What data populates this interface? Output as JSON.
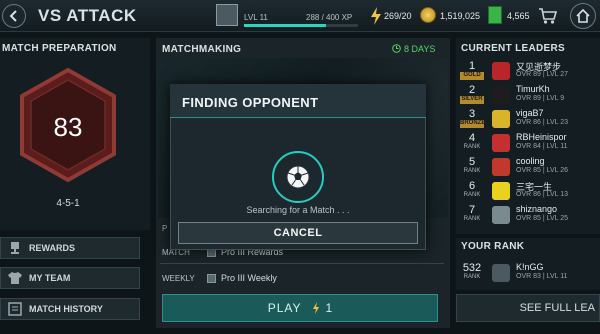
{
  "topbar": {
    "title": "VS ATTACK",
    "level_label": "LVL 11",
    "xp_label": "288 / 400 XP",
    "xp_progress": 0.72,
    "energy": "269/20",
    "coins": "1,519,025",
    "gems": "4,565"
  },
  "match_preparation": {
    "header": "MATCH PREPARATION",
    "team_rating": "83",
    "formation": "4-5-1"
  },
  "side_menu": {
    "rewards": "REWARDS",
    "my_team": "MY TEAM",
    "match_history": "MATCH HISTORY"
  },
  "matchmaking": {
    "header": "MATCHMAKING",
    "days_left": "8 DAYS",
    "prize_header": "P",
    "match_label": "MATCH",
    "match_value": "Pro III Rewards",
    "weekly_label": "WEEKLY",
    "weekly_value": "Pro III Weekly",
    "play_label": "PLAY",
    "play_cost": "1"
  },
  "modal": {
    "title": "FINDING OPPONENT",
    "status": "Searching for a Match . . .",
    "cancel_label": "CANCEL"
  },
  "leaders": {
    "header": "CURRENT LEADERS",
    "rows": [
      {
        "rank": "1",
        "sub": "GOLD",
        "name": "又见逝梦步",
        "stats": "OVR 89 | LVL 27",
        "badge_color": "#b8252b"
      },
      {
        "rank": "2",
        "sub": "SILVER",
        "name": "TimurKh",
        "stats": "OVR 89 | LVL 9",
        "badge_color": "#1d1d1d"
      },
      {
        "rank": "3",
        "sub": "BRONZE",
        "name": "vigaB7",
        "stats": "OVR 86 | LVL 23",
        "badge_color": "#d9b42a"
      },
      {
        "rank": "4",
        "sub": "RANK",
        "name": "RBHeinispor",
        "stats": "OVR 84 | LVL 11",
        "badge_color": "#c43030"
      },
      {
        "rank": "5",
        "sub": "RANK",
        "name": "cooling",
        "stats": "OVR 85 | LVL 26",
        "badge_color": "#c0392b"
      },
      {
        "rank": "6",
        "sub": "RANK",
        "name": "三宅一生",
        "stats": "OVR 86 | LVL 13",
        "badge_color": "#e8d21d"
      },
      {
        "rank": "7",
        "sub": "RANK",
        "name": "shiznango",
        "stats": "OVR 85 | LVL 25",
        "badge_color": "#7a8a8f"
      }
    ]
  },
  "your_rank": {
    "header": "YOUR RANK",
    "rank": "532",
    "sub": "RANK",
    "name": "K!nGG",
    "stats": "OVR 83 | LVL 11"
  },
  "see_full_label": "SEE FULL LEA",
  "colors": {
    "accent": "#28cbbf",
    "panel": "#141d21",
    "hex_ring": "#9a3a36",
    "days_green": "#5bd46a"
  }
}
